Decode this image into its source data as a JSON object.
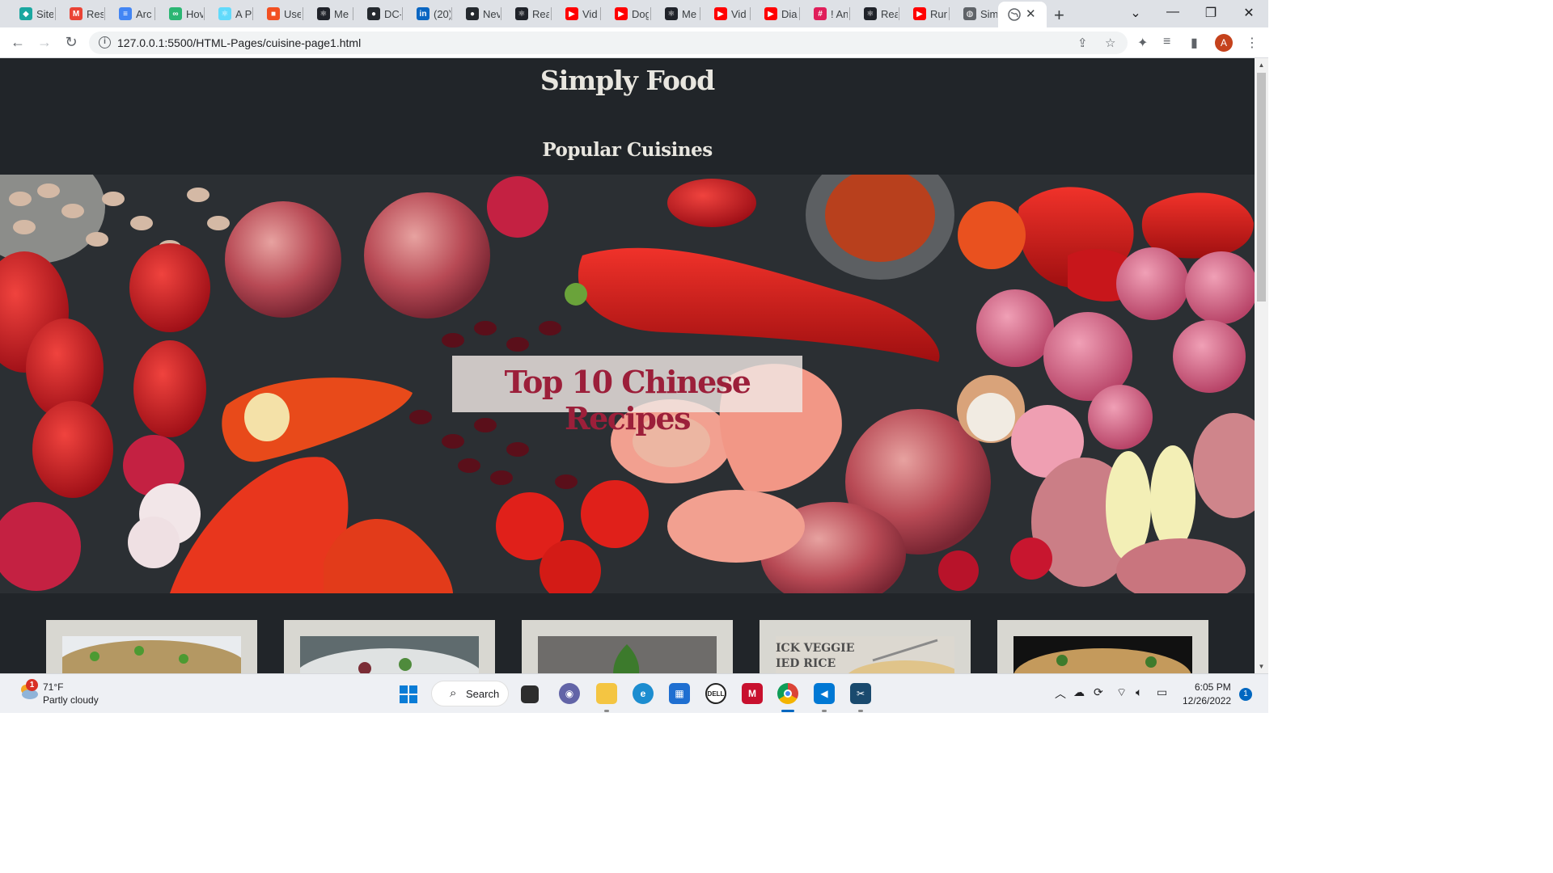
{
  "browser": {
    "tabs": [
      {
        "title": "Site",
        "icon": "diamond-icon",
        "color": "#1aa7a0"
      },
      {
        "title": "Res",
        "icon": "gmail-icon",
        "color": "#ea4335"
      },
      {
        "title": "Arc",
        "icon": "docs-icon",
        "color": "#4285f4"
      },
      {
        "title": "Hov",
        "icon": "link-icon",
        "color": "#2bb673"
      },
      {
        "title": "A P",
        "icon": "react-icon",
        "color": "#61dafb"
      },
      {
        "title": "Use",
        "icon": "windows-icon",
        "color": "#f25022"
      },
      {
        "title": "Me",
        "icon": "react-icon",
        "color": "#20232a"
      },
      {
        "title": "DC-",
        "icon": "github-icon",
        "color": "#24292e"
      },
      {
        "title": "(20)",
        "icon": "linkedin-icon",
        "color": "#0a66c2"
      },
      {
        "title": "Nev",
        "icon": "github-icon",
        "color": "#24292e"
      },
      {
        "title": "Rea",
        "icon": "react-icon",
        "color": "#20232a"
      },
      {
        "title": "Vid",
        "icon": "youtube-icon",
        "color": "#ff0000"
      },
      {
        "title": "Dog",
        "icon": "youtube-icon",
        "color": "#ff0000"
      },
      {
        "title": "Me",
        "icon": "react-icon",
        "color": "#20232a"
      },
      {
        "title": "Vid",
        "icon": "youtube-icon",
        "color": "#ff0000"
      },
      {
        "title": "Dia",
        "icon": "youtube-icon",
        "color": "#ff0000"
      },
      {
        "title": "! An",
        "icon": "slack-icon",
        "color": "#e01e5a"
      },
      {
        "title": "Rea",
        "icon": "react-icon",
        "color": "#20232a"
      },
      {
        "title": "Run",
        "icon": "youtube-icon",
        "color": "#ff0000"
      },
      {
        "title": "Sim",
        "icon": "globe-icon",
        "color": "#5f6368"
      }
    ],
    "url": "127.0.0.1:5500/HTML-Pages/cuisine-page1.html",
    "profile_initial": "A"
  },
  "page": {
    "site_title": "Simply Food",
    "section_title": "Popular Cuisines",
    "hero_title": "Top 10 Chinese Recipes",
    "card_overlay_text": [
      "ICK VEGGIE",
      "IED RICE"
    ]
  },
  "taskbar": {
    "weather_temp": "71°F",
    "weather_desc": "Partly cloudy",
    "weather_badge": "1",
    "search_label": "Search",
    "time": "6:05 PM",
    "date": "12/26/2022",
    "notification_count": "1"
  }
}
